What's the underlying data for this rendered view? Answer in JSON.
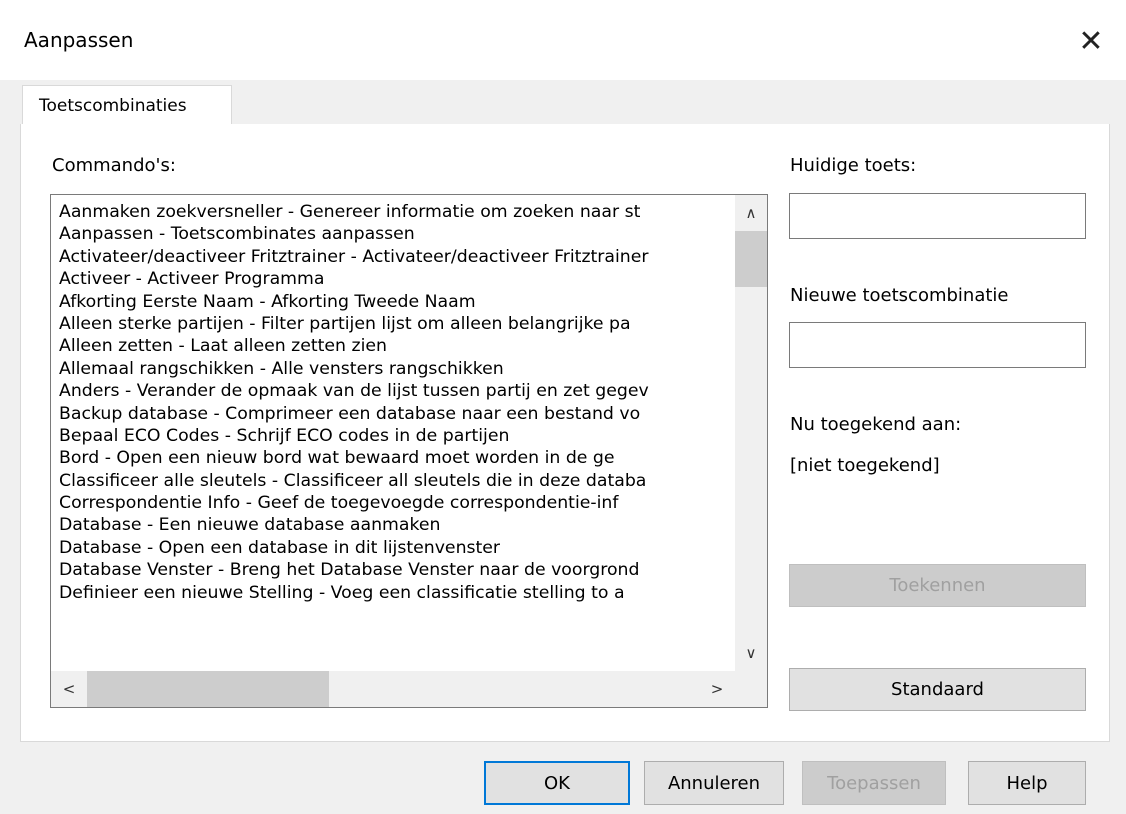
{
  "window": {
    "title": "Aanpassen",
    "close_symbol": "✕"
  },
  "tabs": [
    {
      "label": "Toetscombinaties",
      "active": true
    }
  ],
  "commands": {
    "label": "Commando's:",
    "items": [
      "Aanmaken zoekversneller - Genereer informatie om zoeken naar st",
      "Aanpassen - Toetscombinates aanpassen",
      "Activateer/deactiveer Fritztrainer - Activateer/deactiveer Fritztrainer",
      "Activeer - Activeer Programma",
      "Afkorting Eerste Naam - Afkorting Tweede Naam",
      "Alleen sterke partijen - Filter partijen lijst om alleen belangrijke pa",
      "Alleen zetten - Laat alleen zetten zien",
      "Allemaal rangschikken - Alle vensters rangschikken",
      "Anders - Verander de opmaak van de lijst tussen partij en zet gegev",
      "Backup database - Comprimeer een database naar een bestand vo",
      "Bepaal ECO Codes - Schrijf ECO codes in de partijen",
      "Bord - Open een nieuw bord wat bewaard moet worden in de ge",
      "Classificeer alle sleutels - Classificeer all sleutels die in deze databa",
      "Correspondentie Info - Geef de toegevoegde correspondentie-inf",
      "Database - Een nieuwe database aanmaken",
      "Database - Open een database in dit lijstenvenster",
      "Database Venster - Breng het Database Venster naar de voorgrond",
      "Definieer een nieuwe Stelling - Voeg een classificatie stelling to a"
    ],
    "scroll": {
      "up": "∧",
      "down": "∨",
      "left": "<",
      "right": ">"
    }
  },
  "current_key": {
    "label": "Huidige toets:",
    "value": ""
  },
  "new_combo": {
    "label": "Nieuwe toetscombinatie",
    "value": ""
  },
  "assigned": {
    "label": "Nu toegekend aan:",
    "value": "[niet toegekend]"
  },
  "side_buttons": {
    "assign": "Toekennen",
    "default": "Standaard"
  },
  "footer": {
    "ok": "OK",
    "cancel": "Annuleren",
    "apply": "Toepassen",
    "help": "Help"
  }
}
